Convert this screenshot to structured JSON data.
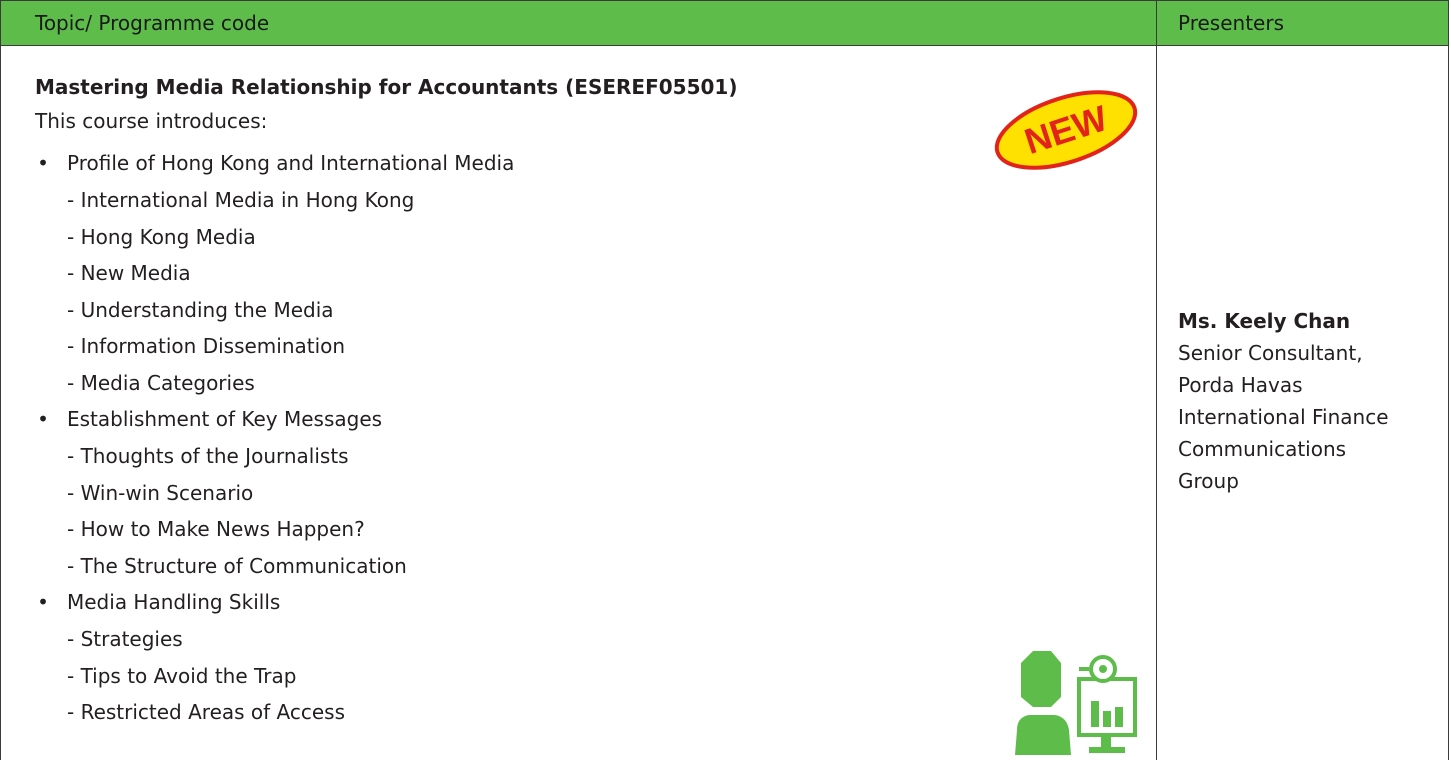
{
  "header": {
    "topic_label": "Topic/ Programme code",
    "presenters_label": "Presenters"
  },
  "course": {
    "title": "Mastering Media Relationship for Accountants (ESEREF05501)",
    "intro": "This course introduces:",
    "badge": "NEW",
    "topics": [
      {
        "label": "Profile of Hong Kong and International Media",
        "items": [
          "- International Media in Hong Kong",
          "- Hong Kong Media",
          "- New Media",
          "- Understanding the Media",
          "- Information Dissemination",
          "- Media Categories"
        ]
      },
      {
        "label": "Establishment of Key Messages",
        "items": [
          "- Thoughts of the Journalists",
          "- Win-win Scenario",
          "- How to Make News Happen?",
          "- The Structure of Communication"
        ]
      },
      {
        "label": "Media Handling Skills",
        "items": [
          "- Strategies",
          "- Tips to Avoid the Trap",
          "- Restricted Areas of Access"
        ]
      }
    ]
  },
  "presenter": {
    "name": "Ms. Keely Chan",
    "lines": [
      "Senior Consultant,",
      "Porda Havas",
      "International Finance",
      "Communications",
      "Group"
    ]
  },
  "colors": {
    "header_green": "#5ebd4a",
    "badge_yellow": "#ffe100",
    "badge_red": "#e2231a",
    "icon_green": "#5ebd4a"
  }
}
